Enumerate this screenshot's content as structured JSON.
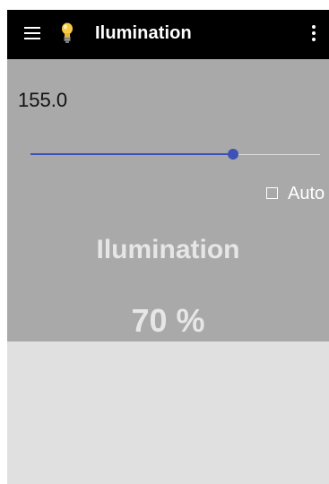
{
  "app_bar": {
    "title": "Ilumination",
    "menu_icon": "menu-icon",
    "app_icon": "light-bulb-icon",
    "overflow_icon": "more-vert-icon",
    "background": "#000000"
  },
  "panel": {
    "value_readout": "155.0",
    "slider": {
      "value": 155,
      "fraction": 0.7,
      "color": "#3f51b5"
    },
    "auto_checkbox": {
      "label": "Auto",
      "checked": false
    },
    "section_title": "Ilumination",
    "percent_label": "70 %",
    "background": "#a9a9a9"
  }
}
